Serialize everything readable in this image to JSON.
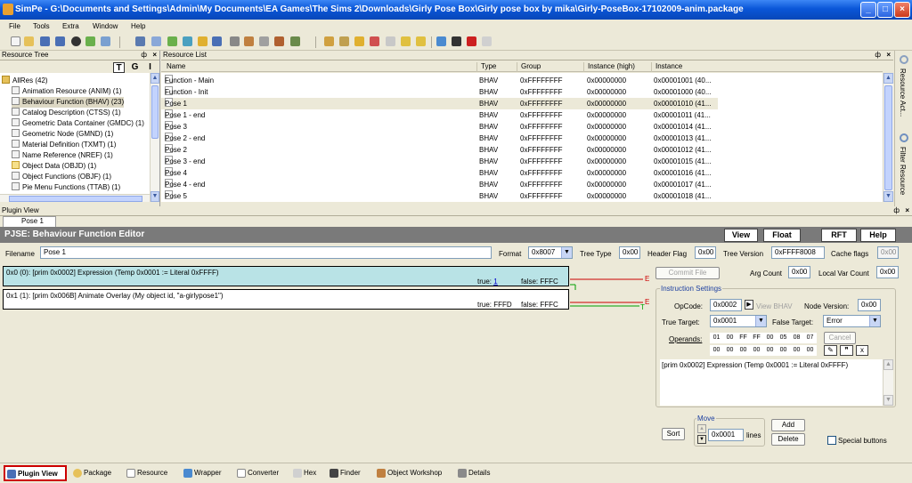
{
  "window": {
    "title": "SimPe - G:\\Documents and Settings\\Admin\\My Documents\\EA Games\\The Sims 2\\Downloads\\Girly Pose Box\\Girly pose box by mika\\Girly-PoseBox-17102009-anim.package",
    "min": "_",
    "max": "□",
    "close": "×"
  },
  "menu": [
    "File",
    "Tools",
    "Extra",
    "Window",
    "Help"
  ],
  "resource_tree": {
    "title": "Resource Tree",
    "pin": "ф",
    "close": "×",
    "toggles": [
      "T",
      "G",
      "I"
    ],
    "items": [
      {
        "label": "AllRes (42)"
      },
      {
        "label": "Animation Resource (ANIM) (1)"
      },
      {
        "label": "Behaviour Function (BHAV) (23)"
      },
      {
        "label": "Catalog Description (CTSS) (1)"
      },
      {
        "label": "Geometric Data Container (GMDC) (1)"
      },
      {
        "label": "Geometric Node (GMND) (1)"
      },
      {
        "label": "Material Definition (TXMT) (1)"
      },
      {
        "label": "Name Reference (NREF) (1)"
      },
      {
        "label": "Object Data (OBJD) (1)"
      },
      {
        "label": "Object Functions (OBJF) (1)"
      },
      {
        "label": "Pie Menu Functions (TTAB) (1)"
      }
    ]
  },
  "resource_list": {
    "title": "Resource List",
    "pin": "ф",
    "close": "×",
    "columns": [
      "Name",
      "Type",
      "Group",
      "Instance (high)",
      "Instance"
    ],
    "rows": [
      [
        "Function - Main",
        "BHAV",
        "0xFFFFFFFF",
        "0x00000000",
        "0x00001001 (40..."
      ],
      [
        "Function - Init",
        "BHAV",
        "0xFFFFFFFF",
        "0x00000000",
        "0x00001000 (40..."
      ],
      [
        "Pose 1",
        "BHAV",
        "0xFFFFFFFF",
        "0x00000000",
        "0x00001010 (41..."
      ],
      [
        "Pose 1 - end",
        "BHAV",
        "0xFFFFFFFF",
        "0x00000000",
        "0x00001011 (41..."
      ],
      [
        "Pose 3",
        "BHAV",
        "0xFFFFFFFF",
        "0x00000000",
        "0x00001014 (41..."
      ],
      [
        "Pose 2 - end",
        "BHAV",
        "0xFFFFFFFF",
        "0x00000000",
        "0x00001013 (41..."
      ],
      [
        "Pose 2",
        "BHAV",
        "0xFFFFFFFF",
        "0x00000000",
        "0x00001012 (41..."
      ],
      [
        "Pose 3 - end",
        "BHAV",
        "0xFFFFFFFF",
        "0x00000000",
        "0x00001015 (41..."
      ],
      [
        "Pose 4",
        "BHAV",
        "0xFFFFFFFF",
        "0x00000000",
        "0x00001016 (41..."
      ],
      [
        "Pose 4 - end",
        "BHAV",
        "0xFFFFFFFF",
        "0x00000000",
        "0x00001017 (41..."
      ],
      [
        "Pose 5",
        "BHAV",
        "0xFFFFFFFF",
        "0x00000000",
        "0x00001018 (41..."
      ]
    ]
  },
  "side_tabs": [
    "Resource Act...",
    "Filter Resource"
  ],
  "plugin": {
    "title": "Plugin View",
    "pin": "ф",
    "close": "×",
    "tab": "Pose 1",
    "editor_title": "PJSE: Behaviour Function Editor",
    "buttons": {
      "view": "View",
      "float": "Float",
      "rft": "RFT",
      "help": "Help"
    },
    "filename_label": "Filename",
    "filename": "Pose 1",
    "format_label": "Format",
    "format": "0x8007",
    "tree_type_label": "Tree Type",
    "tree_type": "0x00",
    "header_flag_label": "Header Flag",
    "header_flag": "0x00",
    "tree_version_label": "Tree Version",
    "tree_version": "0xFFFF8008",
    "cache_flags_label": "Cache flags",
    "cache_flags": "0x00",
    "instructions": [
      {
        "text": "0x0 (0): [prim 0x0002] Expression (Temp 0x0001 := Literal 0xFFFF)",
        "true_label": "true:",
        "true_val": "1",
        "false": "false: FFFC"
      },
      {
        "text": "0x1 (1): [prim 0x006B] Animate Overlay (My object id, \"a-girlypose1\")",
        "true_label": "true: FFFD",
        "true_val": "",
        "false": "false: FFFC"
      }
    ],
    "marks": {
      "e1": "E",
      "e2": "E",
      "t1": "T"
    },
    "commit_file": "Commit File",
    "arg_count_label": "Arg Count",
    "arg_count": "0x00",
    "local_var_label": "Local Var Count",
    "local_var": "0x00",
    "instr_settings": {
      "title": "Instruction Settings",
      "opcode_label": "OpCode:",
      "opcode": "0x0002",
      "view_bhav": "View BHAV",
      "node_version_label": "Node Version:",
      "node_version": "0x00",
      "true_target_label": "True Target:",
      "true_target": "0x0001",
      "false_target_label": "False Target:",
      "false_target": "Error",
      "operands_label": "Operands:",
      "cancel": "Cancel",
      "operands_row1": [
        "01",
        "00",
        "FF",
        "FF",
        "00",
        "05",
        "08",
        "07"
      ],
      "operands_row2": [
        "00",
        "00",
        "00",
        "00",
        "00",
        "00",
        "00",
        "00"
      ],
      "description": "[prim 0x0002] Expression (Temp 0x0001 := Literal 0xFFFF)"
    },
    "move_label": "Move",
    "move_value": "0x0001",
    "lines_label": "lines",
    "sort": "Sort",
    "add": "Add",
    "delete": "Delete",
    "special_buttons": "Special buttons"
  },
  "status_tabs": [
    "Plugin View",
    "Package",
    "Resource",
    "Wrapper",
    "Converter",
    "Hex",
    "Finder",
    "Object Workshop",
    "Details"
  ],
  "colors": {
    "title_bar": "#0a56d8",
    "selected_instruction": "#b9e3e6",
    "editor_bar": "#7a7a7a",
    "active_tab_border": "#cc0000"
  }
}
